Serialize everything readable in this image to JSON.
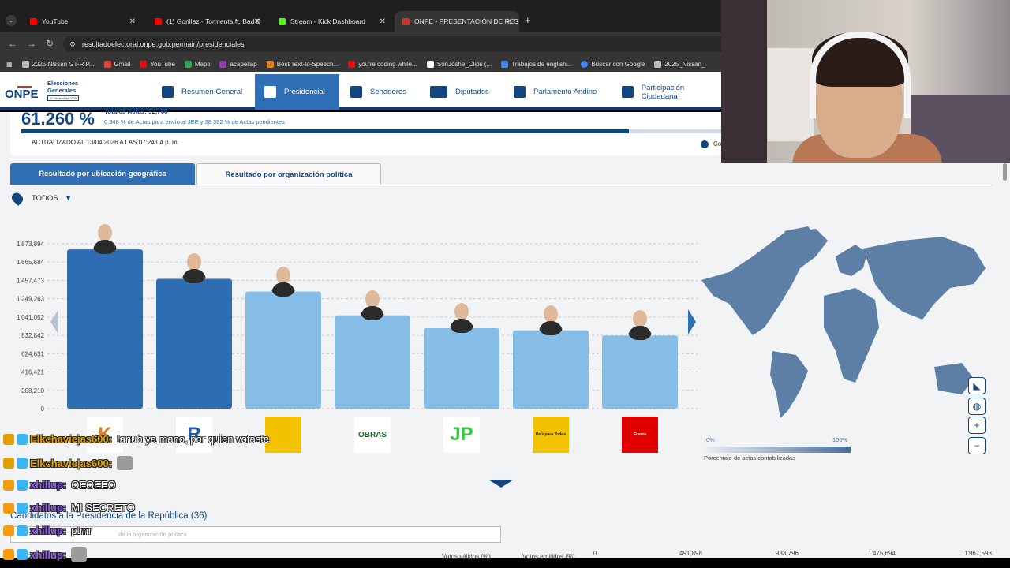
{
  "browser": {
    "tabs": [
      {
        "title": "YouTube",
        "color": "#ff0000"
      },
      {
        "title": "(1) Gorillaz - Tormenta ft. Bad B",
        "color": "#ff0000"
      },
      {
        "title": "Stream - Kick Dashboard",
        "color": "#53fc18"
      },
      {
        "title": "ONPE - PRESENTACIÓN DE RES",
        "color": "#c0392b"
      }
    ],
    "url": "resultadoelectoral.onpe.gob.pe/main/presidenciales",
    "bookmarks": [
      {
        "label": "2025 Nissan GT-R P...",
        "color": "#bbbbbb"
      },
      {
        "label": "Gmail",
        "color": "#ea4335"
      },
      {
        "label": "YouTube",
        "color": "#ff0000"
      },
      {
        "label": "Maps",
        "color": "#34a853"
      },
      {
        "label": "acapellap",
        "color": "#8e44ad"
      },
      {
        "label": "Best Text-to-Speech...",
        "color": "#e67e22"
      },
      {
        "label": "you're coding while...",
        "color": "#ff0000"
      },
      {
        "label": "SonJoshe_Clips",
        "color": "#ffffff"
      },
      {
        "label": "(...",
        "color": "#ffffff"
      },
      {
        "label": "Trabajos de english...",
        "color": "#4285f4"
      },
      {
        "label": "Buscar con Google",
        "color": "#4285f4"
      },
      {
        "label": "2025_Nissan_",
        "color": "#bbbbbb"
      }
    ]
  },
  "site": {
    "logo_text": "ONPE",
    "logo_title_1": "Elecciones",
    "logo_title_2": "Generales",
    "logo_date": "12 de abril de 2026",
    "menu": [
      {
        "label": "Resumen General",
        "icon": "grid-icon"
      },
      {
        "label": "Presidencial",
        "icon": "seal-icon",
        "active": true
      },
      {
        "label": "Senadores",
        "icon": "senate-icon"
      },
      {
        "label": "Diputados",
        "icon": "building-icon"
      },
      {
        "label": "Parlamento Andino",
        "icon": "andino-icon"
      },
      {
        "label": "Participación Ciudadana",
        "icon": "people-icon"
      }
    ]
  },
  "progress": {
    "percent": "61.260 %",
    "fraction": 0.8683,
    "line1": "Totales Actas: 92,766",
    "line2": "0.348 % de Actas para envío al JEE y 38.392 % de Actas pendientes",
    "updated": "ACTUALIZADO AL 13/04/2026 A LAS 07:24:04 p. m.",
    "legend_label": "Co"
  },
  "view_tabs": {
    "geo": "Resultado por ubicación geográfica",
    "org": "Resultado por organización política"
  },
  "filter": {
    "label": "TODOS"
  },
  "chart_data": {
    "type": "bar",
    "y_ticks": [
      "1'873,894",
      "1'665,684",
      "1'457,473",
      "1'249,263",
      "1'041,052",
      "832,842",
      "624,631",
      "416,421",
      "208,210",
      "0"
    ],
    "ylim": [
      0,
      1873894
    ],
    "values": [
      1810000,
      1475000,
      1330000,
      1060000,
      915000,
      890000,
      830000
    ],
    "highlighted": [
      true,
      true,
      false,
      false,
      false,
      false,
      false
    ],
    "parties": [
      {
        "name": "K",
        "bg": "#ffffff",
        "fg": "#e67e22"
      },
      {
        "name": "R",
        "bg": "#ffffff",
        "fg": "#1b5fa8"
      },
      {
        "name": "",
        "bg": "#f2c200",
        "fg": "#c0392b"
      },
      {
        "name": "OBRAS",
        "bg": "#ffffff",
        "fg": "#1e6b2d"
      },
      {
        "name": "JP",
        "bg": "#ffffff",
        "fg": "#2ecc40"
      },
      {
        "name": "País para Todos",
        "bg": "#f2c200",
        "fg": "#111111"
      },
      {
        "name": "Fuerza",
        "bg": "#e00000",
        "fg": "#ffffff"
      }
    ],
    "colors": {
      "dark": "#2f6db3",
      "light": "#86bde6",
      "grid": "#c9d0d8"
    }
  },
  "map": {
    "scale_min": "0%",
    "scale_max": "100%",
    "scale_caption": "Porcentaje de actas contabilizadas",
    "controls": [
      "peru-icon",
      "globe-icon",
      "zoom-in-icon",
      "zoom-out-icon"
    ]
  },
  "candidates": {
    "title": "Candidatos a la Presidencia de la República (36)",
    "search_placeholder": "de la organización política",
    "col_valid": "Votos válidos (%)",
    "col_emitted": "Votos emitidos (%)",
    "axis": [
      "0",
      "491,898",
      "983,796",
      "1'475,694",
      "1'967,593"
    ]
  },
  "chat": [
    {
      "user": "Elkchaviejas600:",
      "msg": "!anub ya mano, por quien votaste",
      "badge": "#e0a100"
    },
    {
      "user": "Elkchaviejas600:",
      "msg": "",
      "badge": "#e0a100",
      "emote": true
    },
    {
      "user": "xhillup:",
      "msg": "OEOEEO",
      "badge": "#f39c12",
      "purple": true
    },
    {
      "user": "xhillup:",
      "msg": "MI SECRETO",
      "badge": "#f39c12",
      "purple": true
    },
    {
      "user": "xhillup:",
      "msg": "ptmr",
      "badge": "#f39c12",
      "purple": true
    },
    {
      "user": "xhillup:",
      "msg": "",
      "badge": "#f39c12",
      "purple": true,
      "emote": true
    }
  ]
}
